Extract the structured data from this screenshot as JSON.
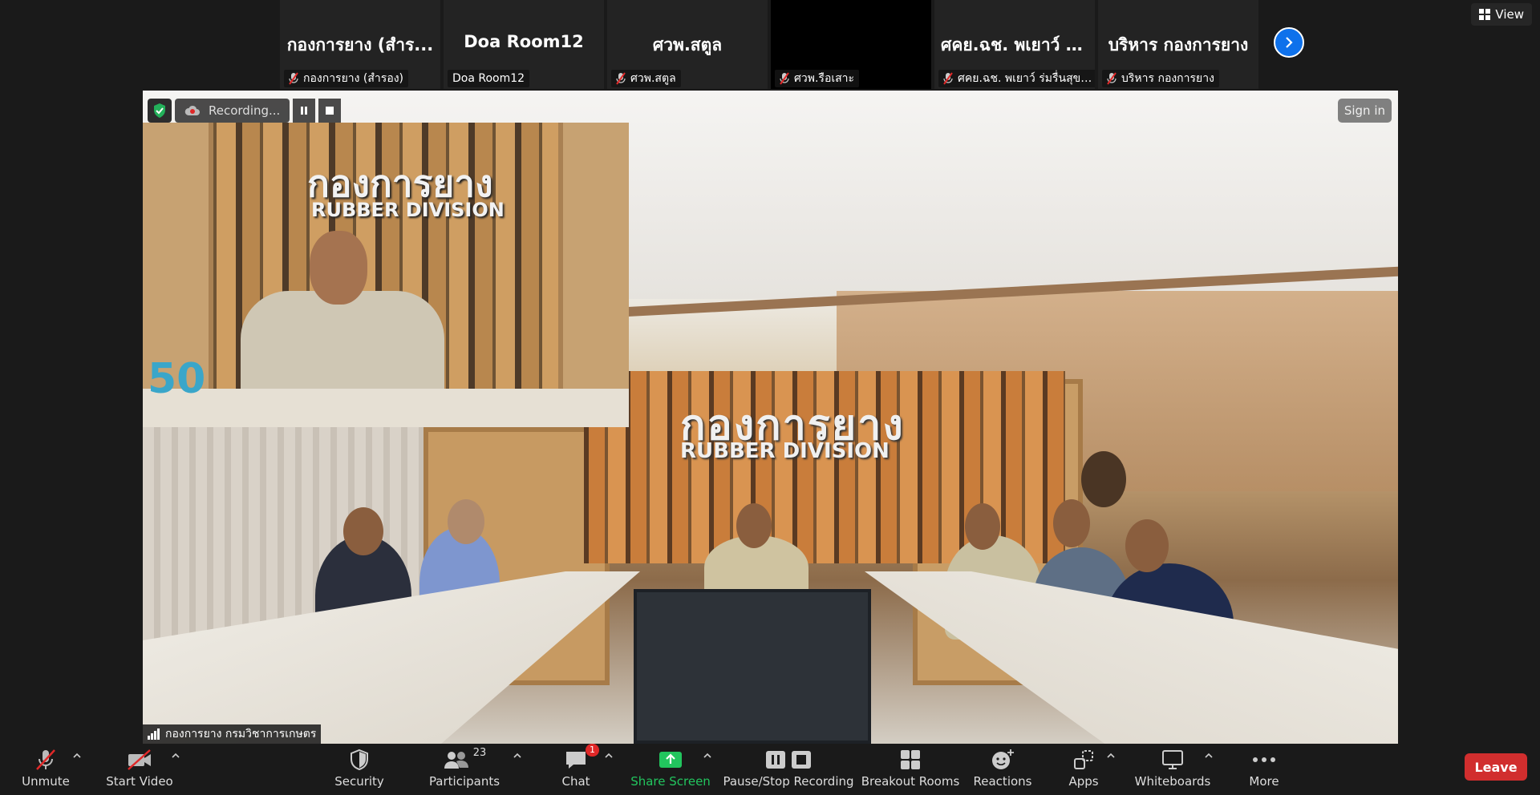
{
  "strip": {
    "tiles": [
      {
        "big": "กองการยาง (สำร...",
        "tag": "กองการยาง (สำรอง)",
        "muted": true
      },
      {
        "big": "Doa Room12",
        "tag": "Doa Room12",
        "muted": false
      },
      {
        "big": "ศวพ.สตูล",
        "tag": "ศวพ.สตูล",
        "muted": true
      },
      {
        "big": "",
        "tag": "ศวพ.รือเสาะ",
        "muted": true
      },
      {
        "big": "ศคย.ฉช. พเยาว์ ร่...",
        "tag": "ศคย.ฉช. พเยาว์ ร่มรื่นสุขา...",
        "muted": true
      },
      {
        "big": "บริหาร กองการยาง",
        "tag": "บริหาร กองการยาง",
        "muted": true
      }
    ],
    "view_label": "View"
  },
  "main": {
    "recording_label": "Recording...",
    "sign_in_label": "Sign in",
    "speaker_name": "กองการยาง กรมวิชาการเกษตร",
    "background_title": "กองการยาง",
    "background_subtitle": "RUBBER DIVISION",
    "pip_title": "กองการยาง",
    "pip_subtitle": "RUBBER DIVISION",
    "pip_anniversary": "50"
  },
  "toolbar": {
    "unmute": "Unmute",
    "start_video": "Start Video",
    "security": "Security",
    "participants": "Participants",
    "participants_count": "23",
    "chat": "Chat",
    "chat_badge": "1",
    "share_screen": "Share Screen",
    "pause_stop_recording": "Pause/Stop Recording",
    "breakout_rooms": "Breakout Rooms",
    "reactions": "Reactions",
    "apps": "Apps",
    "whiteboards": "Whiteboards",
    "more": "More",
    "leave": "Leave"
  },
  "colors": {
    "accent_blue": "#0e71eb",
    "share_green": "#22c55e",
    "leave_red": "#d12e2e",
    "mute_red": "#e02828",
    "toolbar_bg": "#1a1a1a"
  }
}
